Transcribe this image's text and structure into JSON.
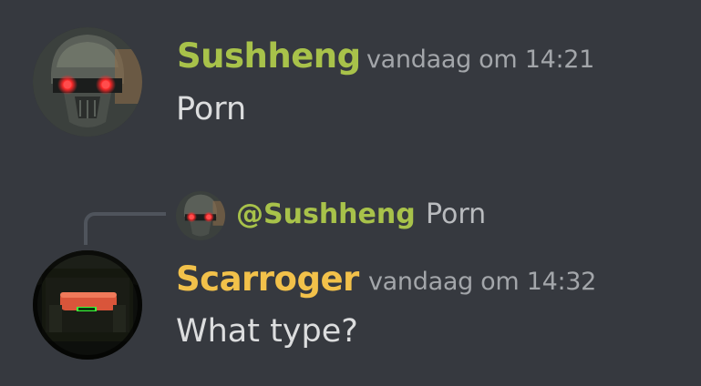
{
  "colors": {
    "background": "#36393f",
    "sushheng_name": "#a8c24a",
    "scarroger_name": "#f2c14a",
    "message_text": "#dcddde",
    "timestamp_text": "#a3a6aa",
    "reply_spine": "#4f545c"
  },
  "messages": [
    {
      "author": "Sushheng",
      "timestamp": "vandaag om 14:21",
      "content": "Porn",
      "avatar_icon": "masked-soldier-red-eyes-avatar"
    },
    {
      "reply": {
        "mention": "@Sushheng",
        "preview": "Porn",
        "avatar_icon": "masked-soldier-red-eyes-avatar"
      },
      "author": "Scarroger",
      "timestamp": "vandaag om 14:32",
      "content": "What type?",
      "avatar_icon": "visor-helmet-avatar"
    }
  ]
}
